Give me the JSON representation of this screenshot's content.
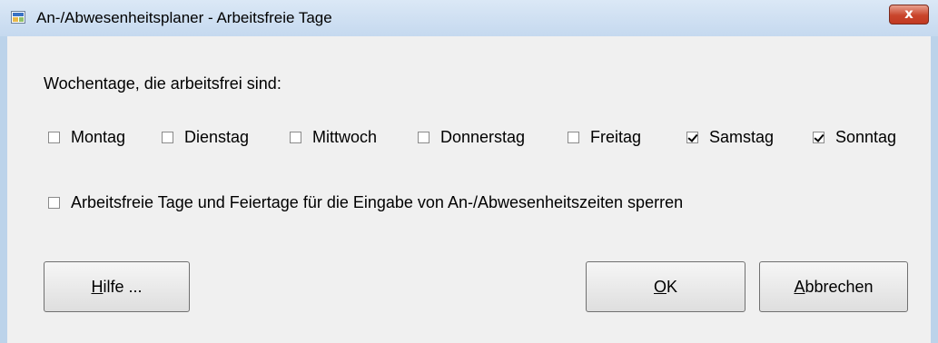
{
  "window": {
    "title": "An-/Abwesenheitsplaner - Arbeitsfreie Tage",
    "close_glyph": "x"
  },
  "prompt_label": "Wochentage, die arbeitsfrei sind:",
  "days": [
    {
      "label": "Montag",
      "checked": false
    },
    {
      "label": "Dienstag",
      "checked": false
    },
    {
      "label": "Mittwoch",
      "checked": false
    },
    {
      "label": "Donnerstag",
      "checked": false
    },
    {
      "label": "Freitag",
      "checked": false
    },
    {
      "label": "Samstag",
      "checked": true
    },
    {
      "label": "Sonntag",
      "checked": true
    }
  ],
  "lock_option": {
    "label": "Arbeitsfreie Tage und Feiertage für die Eingabe von An-/Abwesenheitszeiten sperren",
    "checked": false
  },
  "buttons": {
    "help": {
      "mnemonic": "H",
      "rest": "ilfe ..."
    },
    "ok": {
      "mnemonic": "O",
      "rest": "K"
    },
    "cancel": {
      "mnemonic": "A",
      "rest": "bbrechen"
    }
  },
  "colors": {
    "frame": "#bcd3ea",
    "client": "#f0f0f0",
    "close_button": "#c9452c"
  }
}
